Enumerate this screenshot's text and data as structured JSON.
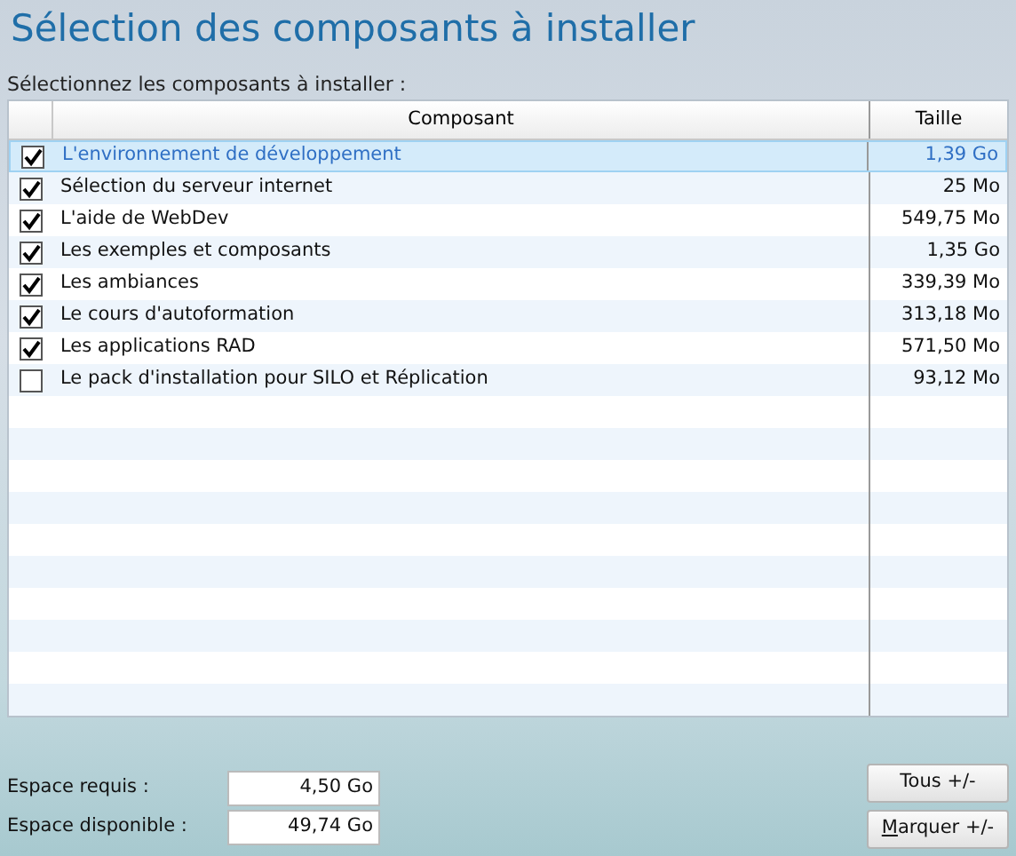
{
  "title": "Sélection des composants à installer",
  "subtitle": "Sélectionnez les composants à installer :",
  "table": {
    "columns": [
      "Composant",
      "Taille"
    ],
    "rows": [
      {
        "name": "L'environnement de développement",
        "size": "1,39 Go",
        "checked": true,
        "selected": true
      },
      {
        "name": "Sélection du serveur internet",
        "size": "25 Mo",
        "checked": true,
        "selected": false
      },
      {
        "name": "L'aide de WebDev",
        "size": "549,75 Mo",
        "checked": true,
        "selected": false
      },
      {
        "name": "Les exemples et composants",
        "size": "1,35 Go",
        "checked": true,
        "selected": false
      },
      {
        "name": "Les ambiances",
        "size": "339,39 Mo",
        "checked": true,
        "selected": false
      },
      {
        "name": "Le cours d'autoformation",
        "size": "313,18 Mo",
        "checked": true,
        "selected": false
      },
      {
        "name": "Les applications RAD",
        "size": "571,50 Mo",
        "checked": true,
        "selected": false
      },
      {
        "name": "Le pack d'installation pour SILO et Réplication",
        "size": "93,12 Mo",
        "checked": false,
        "selected": false
      }
    ]
  },
  "fields": [
    {
      "label": "Espace requis :",
      "value": "4,50 Go"
    },
    {
      "label": "Espace disponible :",
      "value": "49,74 Go"
    }
  ],
  "buttons": [
    {
      "label": "Tous +/-",
      "underline_first": false
    },
    {
      "label": "Marquer +/-",
      "underline_first": true
    }
  ]
}
